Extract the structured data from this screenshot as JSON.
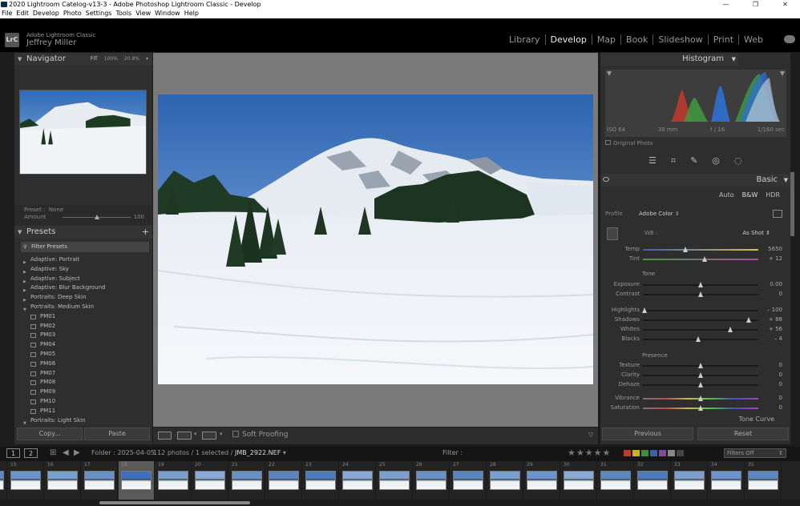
{
  "titlebar": {
    "title": "2020 Lightroom Catelog-v13-3 - Adobe Photoshop Lightroom Classic - Develop",
    "minimize": "—",
    "restore": "❐",
    "close": "✕"
  },
  "menu": [
    "File",
    "Edit",
    "Develop",
    "Photo",
    "Settings",
    "Tools",
    "View",
    "Window",
    "Help"
  ],
  "identity": {
    "badge": "LrC",
    "brand": "Adobe Lightroom Classic",
    "user": "Jeffrey Miller"
  },
  "modules": [
    "Library",
    "Develop",
    "Map",
    "Book",
    "Slideshow",
    "Print",
    "Web"
  ],
  "active_module": "Develop",
  "navigator": {
    "title": "Navigator",
    "zoom": [
      "FIT",
      "100%",
      "20.8%"
    ],
    "zoom_more": "▾"
  },
  "preset_amount": {
    "preset_label": "Preset",
    "preset_value": "None",
    "amount_label": "Amount",
    "amount_value": "100",
    "amount_fraction": 0.5
  },
  "presets": {
    "title": "Presets",
    "add": "+",
    "filter": "Filter Presets",
    "items": [
      {
        "label": "Adaptive: Portrait",
        "sub": false
      },
      {
        "label": "Adaptive: Sky",
        "sub": false
      },
      {
        "label": "Adaptive: Subject",
        "sub": false
      },
      {
        "label": "Adaptive: Blur Background",
        "sub": false
      },
      {
        "label": "Portraits: Deep Skin",
        "sub": false
      },
      {
        "label": "Portraits: Medium Skin",
        "sub": false,
        "open": true
      },
      {
        "label": "PM01",
        "sub": true
      },
      {
        "label": "PM02",
        "sub": true
      },
      {
        "label": "PM03",
        "sub": true
      },
      {
        "label": "PM04",
        "sub": true
      },
      {
        "label": "PM05",
        "sub": true
      },
      {
        "label": "PM06",
        "sub": true
      },
      {
        "label": "PM07",
        "sub": true
      },
      {
        "label": "PM08",
        "sub": true
      },
      {
        "label": "PM09",
        "sub": true
      },
      {
        "label": "PM10",
        "sub": true
      },
      {
        "label": "PM11",
        "sub": true
      },
      {
        "label": "Portraits: Light Skin",
        "sub": false,
        "open": true
      }
    ]
  },
  "left_buttons": {
    "copy": "Copy...",
    "paste": "Paste"
  },
  "toolbar": {
    "soft_proofing": "Soft Proofing"
  },
  "histogram": {
    "title": "Histogram",
    "iso": "ISO 64",
    "focal": "38 mm",
    "aperture": "f / 16",
    "shutter": "1/160 sec",
    "original_photo": "Original Photo"
  },
  "basic": {
    "title": "Basic",
    "treatment": [
      "Auto",
      "B&W",
      "HDR"
    ],
    "profile_label": "Profile",
    "profile_value": "Adobe Color",
    "wb_label": "WB :",
    "wb_value": "As Shot",
    "tone_label": "Tone",
    "presence_label": "Presence",
    "sliders": [
      {
        "label": "Temp",
        "value": "5650",
        "pos": 0.37,
        "track": "temp"
      },
      {
        "label": "Tint",
        "value": "+ 12",
        "pos": 0.54,
        "track": "tint"
      },
      {
        "label": "Exposure",
        "value": "0.00",
        "pos": 0.5
      },
      {
        "label": "Contrast",
        "value": "0",
        "pos": 0.5
      },
      {
        "label": "Highlights",
        "value": "– 100",
        "pos": 0.02
      },
      {
        "label": "Shadows",
        "value": "+ 88",
        "pos": 0.92
      },
      {
        "label": "Whites",
        "value": "+ 56",
        "pos": 0.76
      },
      {
        "label": "Blacks",
        "value": "– 4",
        "pos": 0.48
      },
      {
        "label": "Texture",
        "value": "0",
        "pos": 0.5
      },
      {
        "label": "Clarity",
        "value": "0",
        "pos": 0.5
      },
      {
        "label": "Dehaze",
        "value": "0",
        "pos": 0.5
      },
      {
        "label": "Vibrance",
        "value": "0",
        "pos": 0.5,
        "track": "vib"
      },
      {
        "label": "Saturation",
        "value": "0",
        "pos": 0.5,
        "track": "sat"
      }
    ],
    "tone_curve": "Tone Curve"
  },
  "right_buttons": {
    "previous": "Previous",
    "reset": "Reset"
  },
  "filmbar": {
    "page1": "1",
    "page2": "2",
    "folder": "Folder : 2025-04-05",
    "count_prefix": "112 photos / 1 selected /",
    "selected_file": "JMB_2922.NEF",
    "filter_label": "Filter :",
    "stars": "★★★★★",
    "label_colors": [
      "#c0392b",
      "#c9b12a",
      "#3f8f3f",
      "#3c5fa8",
      "#7d4d9b",
      "#888888",
      "#444444"
    ],
    "filters_off": "Filters Off"
  },
  "filmstrip": {
    "numbers": [
      "14",
      "15",
      "16",
      "17",
      "18",
      "19",
      "20",
      "21",
      "22",
      "23",
      "24",
      "25",
      "26",
      "27",
      "28",
      "29",
      "30",
      "31",
      "32",
      "33",
      "34",
      "35"
    ],
    "selected_index": 4
  },
  "colors": {
    "accent": "#eeeeee",
    "panel": "#2e2e2e",
    "center_bg": "#7a7a7a"
  }
}
